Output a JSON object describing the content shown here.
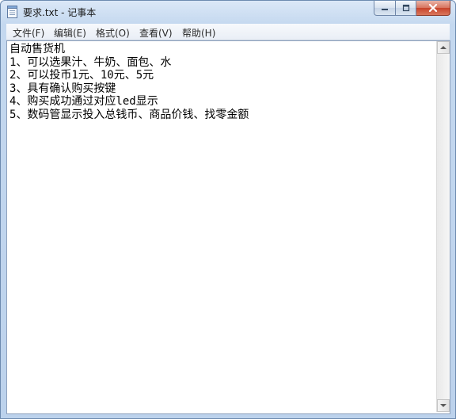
{
  "window": {
    "title": "要求.txt - 记事本"
  },
  "menu": [
    {
      "label": "文件(F)"
    },
    {
      "label": "编辑(E)"
    },
    {
      "label": "格式(O)"
    },
    {
      "label": "查看(V)"
    },
    {
      "label": "帮助(H)"
    }
  ],
  "document": {
    "lines": [
      "自动售货机",
      "1、可以选果汁、牛奶、面包、水",
      "2、可以投币1元、10元、5元",
      "3、具有确认购买按键",
      "4、购买成功通过对应led显示",
      "5、数码管显示投入总钱币、商品价钱、找零金额"
    ]
  },
  "icons": {
    "app": "notepad-icon",
    "minimize": "minimize-icon",
    "maximize": "maximize-icon",
    "close": "close-icon",
    "scroll_up": "chevron-up-icon",
    "scroll_down": "chevron-down-icon"
  },
  "colors": {
    "close_button": "#c7432a",
    "titlebar": "#dbe8f7"
  }
}
